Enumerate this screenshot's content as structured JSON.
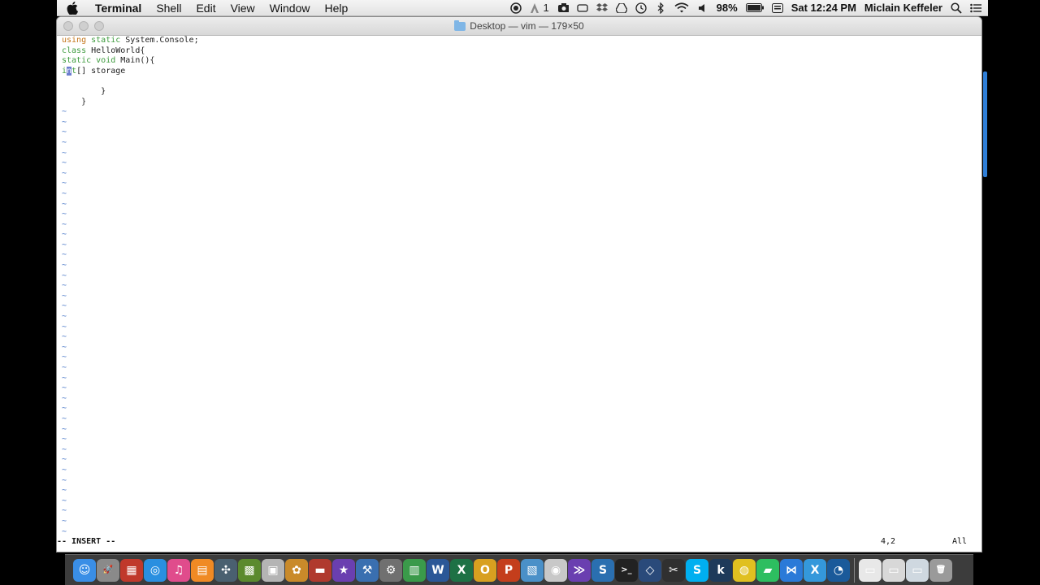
{
  "menubar": {
    "app_name": "Terminal",
    "menus": [
      "Shell",
      "Edit",
      "View",
      "Window",
      "Help"
    ],
    "status": {
      "notification_count": "1",
      "battery": "98%",
      "clock": "Sat 12:24 PM",
      "user": "Miclain Keffeler"
    }
  },
  "window": {
    "title": "Desktop — vim — 179×50"
  },
  "editor": {
    "lines": [
      {
        "parts": [
          {
            "t": "using",
            "c": "kw-orange"
          },
          {
            "t": " "
          },
          {
            "t": "static",
            "c": "kw-green"
          },
          {
            "t": " System.Console;"
          }
        ]
      },
      {
        "parts": [
          {
            "t": "class",
            "c": "kw-green"
          },
          {
            "t": " HelloWorld{"
          }
        ]
      },
      {
        "parts": [
          {
            "t": "static",
            "c": "kw-green"
          },
          {
            "t": " "
          },
          {
            "t": "void",
            "c": "kw-green"
          },
          {
            "t": " Main(){"
          }
        ]
      },
      {
        "parts": [
          {
            "t": "i",
            "c": "kw-green"
          },
          {
            "t": "n",
            "c": "cursor"
          },
          {
            "t": "t",
            "c": "kw-green"
          },
          {
            "t": "[] storage"
          }
        ]
      },
      {
        "parts": [
          {
            "t": ""
          }
        ]
      },
      {
        "parts": [
          {
            "t": "        }"
          }
        ]
      },
      {
        "parts": [
          {
            "t": "    }"
          }
        ]
      }
    ],
    "tilde_char": "~",
    "tilde_count": 42
  },
  "vim_status": {
    "mode": "-- INSERT --",
    "position": "4,2",
    "scroll": "All"
  },
  "dock": {
    "icons": [
      {
        "name": "finder-icon",
        "color": "#3a8ee6",
        "glyph": "☺"
      },
      {
        "name": "launchpad-icon",
        "color": "#8a8a8a",
        "glyph": "🚀"
      },
      {
        "name": "photo-booth-icon",
        "color": "#c0392b",
        "glyph": "▦"
      },
      {
        "name": "safari-icon",
        "color": "#2a8fe0",
        "glyph": "◎"
      },
      {
        "name": "itunes-icon",
        "color": "#e04c8c",
        "glyph": "♫"
      },
      {
        "name": "ibooks-icon",
        "color": "#f08a24",
        "glyph": "▤"
      },
      {
        "name": "xcode-tools-icon",
        "color": "#4a6070",
        "glyph": "✣"
      },
      {
        "name": "minecraft-icon",
        "color": "#5b8a2e",
        "glyph": "▩"
      },
      {
        "name": "preview-icon",
        "color": "#b4b4b4",
        "glyph": "▣"
      },
      {
        "name": "photos-icon",
        "color": "#c98a2a",
        "glyph": "✿"
      },
      {
        "name": "keynote-icon",
        "color": "#b03a2e",
        "glyph": "▬"
      },
      {
        "name": "imovie-star-icon",
        "color": "#6a3fb0",
        "glyph": "★"
      },
      {
        "name": "xcode-icon",
        "color": "#3a6fb0",
        "glyph": "⚒"
      },
      {
        "name": "system-preferences-icon",
        "color": "#707070",
        "glyph": "⚙"
      },
      {
        "name": "numbers-icon",
        "color": "#3a9a4a",
        "glyph": "▥"
      },
      {
        "name": "word-icon",
        "color": "#2b5797",
        "glyph": "W"
      },
      {
        "name": "excel-icon",
        "color": "#1e7145",
        "glyph": "X"
      },
      {
        "name": "outlook-icon",
        "color": "#d8a020",
        "glyph": "O"
      },
      {
        "name": "powerpoint-icon",
        "color": "#c43e1c",
        "glyph": "P"
      },
      {
        "name": "preview-images-icon",
        "color": "#4a90c8",
        "glyph": "▧"
      },
      {
        "name": "game-center-icon",
        "color": "#c8c8c8",
        "glyph": "◉"
      },
      {
        "name": "visual-studio-ide-icon",
        "color": "#6a3fb0",
        "glyph": "≫"
      },
      {
        "name": "sourcetree-icon",
        "color": "#2a6fb0",
        "glyph": "S"
      },
      {
        "name": "terminal-icon",
        "color": "#222222",
        "glyph": ">_"
      },
      {
        "name": "virtualbox-icon",
        "color": "#2a4a7a",
        "glyph": "◇"
      },
      {
        "name": "final-cut-icon",
        "color": "#303030",
        "glyph": "✂"
      },
      {
        "name": "skype-icon",
        "color": "#00aff0",
        "glyph": "S"
      },
      {
        "name": "kindle-icon",
        "color": "#1e3a5a",
        "glyph": "k"
      },
      {
        "name": "chrome-icon",
        "color": "#e0c020",
        "glyph": "◍"
      },
      {
        "name": "evernote-icon",
        "color": "#2dbe60",
        "glyph": "▰"
      },
      {
        "name": "visual-studio-code-icon",
        "color": "#2a7ad8",
        "glyph": "⋈"
      },
      {
        "name": "xamarin-icon",
        "color": "#3498db",
        "glyph": "X"
      },
      {
        "name": "edge-icon",
        "color": "#1a5a9a",
        "glyph": "◔"
      }
    ],
    "right_icons": [
      {
        "name": "document-icon",
        "color": "#e8e8e8",
        "glyph": "▭"
      },
      {
        "name": "downloads-stack-icon",
        "color": "#d8d8d8",
        "glyph": "▭"
      },
      {
        "name": "folder-stack-icon",
        "color": "#cfd8e0",
        "glyph": "▭"
      },
      {
        "name": "trash-icon",
        "color": "#9a9a9a",
        "glyph": "🗑"
      }
    ]
  }
}
